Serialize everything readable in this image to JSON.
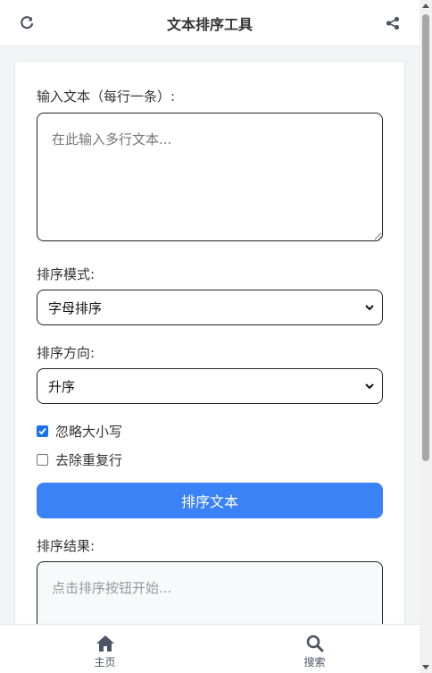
{
  "header": {
    "title": "文本排序工具",
    "left_icon": "refresh-icon",
    "right_icon": "share-icon"
  },
  "form": {
    "input_label": "输入文本（每行一条）:",
    "input_placeholder": "在此输入多行文本...",
    "input_value": "",
    "mode_label": "排序模式:",
    "mode_value": "字母排序",
    "direction_label": "排序方向:",
    "direction_value": "升序",
    "ignore_case_label": "忽略大小写",
    "ignore_case_checked": true,
    "dedupe_label": "去除重复行",
    "dedupe_checked": false,
    "sort_button": "排序文本",
    "result_label": "排序结果:",
    "result_placeholder": "点击排序按钮开始..."
  },
  "nav": {
    "items": [
      {
        "label": "主页",
        "icon": "home-icon"
      },
      {
        "label": "搜索",
        "icon": "search-icon"
      }
    ]
  },
  "colors": {
    "accent": "#3b82f6",
    "nav_icon": "#4b5563",
    "header_icon": "#4b5563"
  }
}
